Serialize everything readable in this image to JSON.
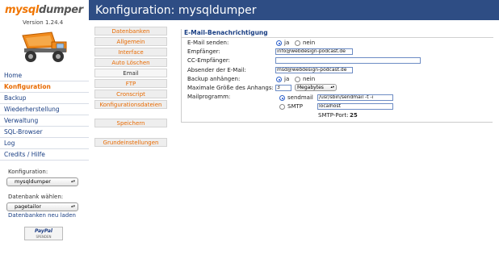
{
  "app": {
    "logo_part1": "mysql",
    "logo_part2": "dumper",
    "version": "Version 1.24.4"
  },
  "nav": {
    "items": [
      {
        "label": "Home",
        "active": false
      },
      {
        "label": "Konfiguration",
        "active": true
      },
      {
        "label": "Backup",
        "active": false
      },
      {
        "label": "Wiederherstellung",
        "active": false
      },
      {
        "label": "Verwaltung",
        "active": false
      },
      {
        "label": "SQL-Browser",
        "active": false
      },
      {
        "label": "Log",
        "active": false
      },
      {
        "label": "Credits / Hilfe",
        "active": false
      }
    ]
  },
  "sidebar": {
    "config_label": "Konfiguration:",
    "config_value": "mysqldumper",
    "db_label": "Datenbank wählen:",
    "db_value": "pagetailor",
    "reload_link": "Datenbanken neu laden",
    "paypal_text": "PayPal",
    "paypal_sub": "SPENDEN"
  },
  "header": {
    "title": "Konfiguration: mysqldumper"
  },
  "tabs": {
    "items": [
      {
        "label": "Datenbanken",
        "current": false
      },
      {
        "label": "Allgemein",
        "current": false
      },
      {
        "label": "Interface",
        "current": false
      },
      {
        "label": "Auto Löschen",
        "current": false
      },
      {
        "label": "Email",
        "current": true
      },
      {
        "label": "FTP",
        "current": false
      },
      {
        "label": "Cronscript",
        "current": false
      },
      {
        "label": "Konfigurationsdateien",
        "current": false
      }
    ],
    "save": "Speichern",
    "defaults": "Grundeinstellungen"
  },
  "email_panel": {
    "title": "E-Mail-Benachrichtigung",
    "send_label": "E-Mail senden:",
    "yes": "ja",
    "no": "nein",
    "recipient_label": "Empfänger:",
    "recipient_value": "info@webdesign-podcast.de",
    "cc_label": "CC-Empfänger:",
    "cc_value": "",
    "sender_label": "Absender der E-Mail:",
    "sender_value": "msd@webdesign-podcast.de",
    "attach_label": "Backup anhängen:",
    "maxsize_label": "Maximale Größe des Anhangs:",
    "maxsize_value": "3",
    "maxsize_unit": "Megabytes",
    "mailer_label": "Mailprogramm:",
    "sendmail_label": "sendmail",
    "sendmail_path": "/usr/sbin/sendmail -t -i",
    "smtp_label": "SMTP",
    "smtp_host": "localhost",
    "smtp_port_label": "SMTP-Port:",
    "smtp_port_value": "25"
  }
}
